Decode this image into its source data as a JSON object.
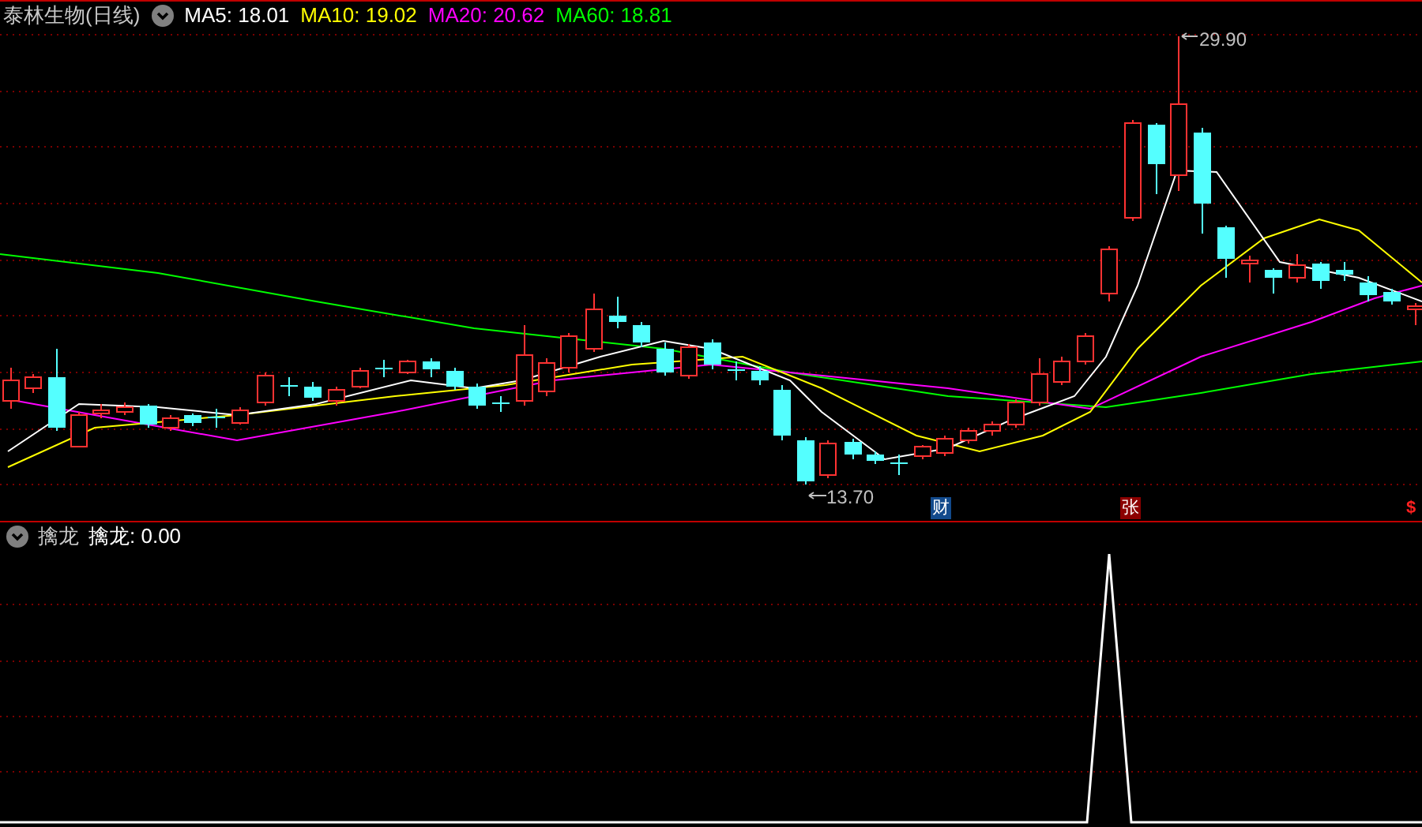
{
  "main_panel": {
    "title": "泰林生物(日线)",
    "indicators": [
      {
        "label": "MA5: 18.01",
        "color": "#ffffff"
      },
      {
        "label": "MA10: 19.02",
        "color": "#ffff00"
      },
      {
        "label": "MA20: 20.62",
        "color": "#ff00ff"
      },
      {
        "label": "MA60: 18.81",
        "color": "#00ff00"
      }
    ],
    "high_label": "29.90",
    "low_label": "13.70",
    "event_marks": [
      {
        "text": "财",
        "kind": "finance"
      },
      {
        "text": "张",
        "kind": "limit-up"
      },
      {
        "text": "$",
        "kind": "dollar"
      }
    ]
  },
  "sub_panel": {
    "title": "擒龙",
    "reading": "擒龙: 0.00"
  }
}
